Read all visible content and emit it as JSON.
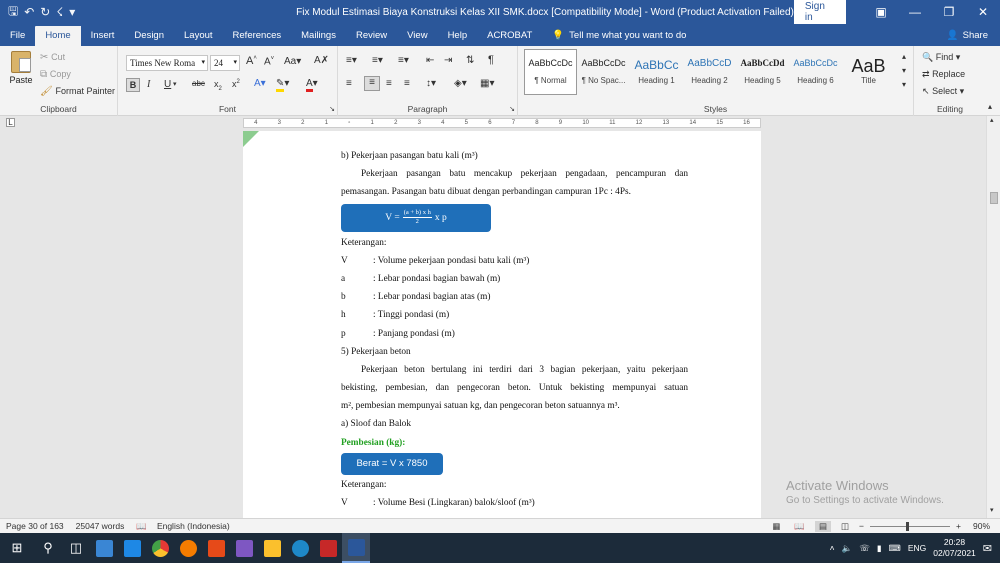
{
  "window": {
    "title": "Fix Modul Estimasi Biaya Konstruksi Kelas XII SMK.docx [Compatibility Mode]  -  Word (Product Activation Failed)",
    "signin_label": "Sign in"
  },
  "tabs": [
    "File",
    "Home",
    "Insert",
    "Design",
    "Layout",
    "References",
    "Mailings",
    "Review",
    "View",
    "Help",
    "ACROBAT"
  ],
  "tell_me": "Tell me what you want to do",
  "share_label": "Share",
  "clipboard": {
    "paste": "Paste",
    "cut": "Cut",
    "copy": "Copy",
    "format_painter": "Format Painter",
    "label": "Clipboard"
  },
  "font": {
    "family": "Times New Roma",
    "size": "24",
    "label": "Font"
  },
  "paragraph": {
    "label": "Paragraph"
  },
  "styles": {
    "label": "Styles",
    "items": [
      {
        "sample": "AaBbCcDc",
        "name": "¶ Normal"
      },
      {
        "sample": "AaBbCcDc",
        "name": "¶ No Spac..."
      },
      {
        "sample": "AaBbCc",
        "name": "Heading 1"
      },
      {
        "sample": "AaBbCcD",
        "name": "Heading 2"
      },
      {
        "sample": "AaBbCcDd",
        "name": "Heading 5"
      },
      {
        "sample": "AaBbCcDc",
        "name": "Heading 6"
      },
      {
        "sample": "AaB",
        "name": "Title"
      }
    ]
  },
  "editing": {
    "find": "Find",
    "replace": "Replace",
    "select": "Select",
    "label": "Editing"
  },
  "ruler_numbers": [
    "4",
    "3",
    "2",
    "1",
    "",
    "1",
    "2",
    "3",
    "4",
    "5",
    "6",
    "7",
    "8",
    "9",
    "10",
    "11",
    "12",
    "13",
    "14",
    "15",
    "16"
  ],
  "document": {
    "heading_b": "b)    Pekerjaan pasangan batu kali (m³)",
    "para1_l1": "Pekerjaan pasangan batu mencakup pekerjaan pengadaan, pencampuran dan",
    "para1_l2": "pemasangan. Pasangan batu dibuat dengan perbandingan campuran 1Pc : 4Ps.",
    "formula1_lhs": "V =",
    "formula1_num": "(a + b) x h",
    "formula1_den": "2",
    "formula1_rhs": "x p",
    "keterangan": "Keterangan:",
    "vars": [
      {
        "k": "V",
        "v": ": Volume pekerjaan pondasi batu kali (m³)"
      },
      {
        "k": "a",
        "v": ": Lebar pondasi bagian bawah (m)"
      },
      {
        "k": "b",
        "v": ": Lebar pondasi bagian atas (m)"
      },
      {
        "k": "h",
        "v": ": Tinggi pondasi (m)"
      },
      {
        "k": "p",
        "v": ": Panjang pondasi (m)"
      }
    ],
    "heading_5": "5)    Pekerjaan beton",
    "para2_l1": "Pekerjaan beton bertulang ini terdiri dari 3 bagian pekerjaan, yaitu pekerjaan",
    "para2_l2": "bekisting, pembesian, dan pengecoran beton. Untuk bekisting mempunyai satuan",
    "para2_l3": "m², pembesian mempunyai satuan kg, dan pengecoran beton satuannya m³.",
    "heading_a": "a)    Sloof dan Balok",
    "pembesian": "Pembesian (kg):",
    "formula2": "Berat =  V x 7850",
    "keterangan2": "Keterangan:",
    "var_last": {
      "k": "V",
      "v": ": Volume Besi (Lingkaran) balok/sloof (m³)"
    }
  },
  "watermark": {
    "line1": "Activate Windows",
    "line2": "Go to Settings to activate Windows."
  },
  "status": {
    "page": "Page 30 of 163",
    "words": "25047 words",
    "language": "English (Indonesia)",
    "zoom": "90%"
  },
  "tray": {
    "lang": "ENG",
    "time": "20:28",
    "date": "02/07/2021"
  },
  "colors": {
    "word_blue": "#2b579a",
    "formula_blue": "#1f6fb9",
    "green": "#22a022"
  }
}
